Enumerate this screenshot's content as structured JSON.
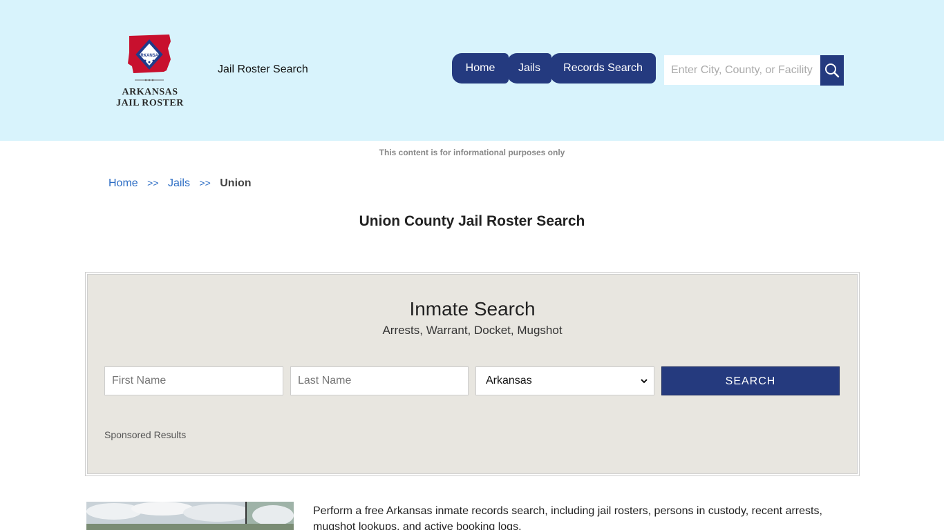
{
  "header": {
    "logo": {
      "state_badge": "ARKANSAS",
      "line1": "ARKANSAS",
      "line2": "JAIL ROSTER"
    },
    "site_title": "Jail Roster Search",
    "nav": [
      {
        "label": "Home"
      },
      {
        "label": "Jails"
      },
      {
        "label": "Records Search"
      }
    ],
    "search": {
      "placeholder": "Enter City, County, or Facility",
      "icon": "search-icon"
    }
  },
  "info_notice": "This content is for informational purposes only",
  "breadcrumb": {
    "items": [
      "Home",
      "Jails"
    ],
    "separator": ">>",
    "current": "Union"
  },
  "page_title": "Union County Jail Roster Search",
  "inmate_search": {
    "title": "Inmate Search",
    "subtitle": "Arrests, Warrant, Docket, Mugshot",
    "first_name_placeholder": "First Name",
    "last_name_placeholder": "Last Name",
    "state_selected": "Arkansas",
    "button_label": "SEARCH",
    "sponsored_label": "Sponsored Results"
  },
  "description": "Perform a free Arkansas inmate records search, including jail rosters, persons in custody, recent arrests, mugshot lookups, and active booking logs.",
  "colors": {
    "header_bg": "#d8f3fc",
    "nav_bg": "#243a7f",
    "link": "#2b6cc4",
    "panel_bg": "#e8e6e0"
  }
}
